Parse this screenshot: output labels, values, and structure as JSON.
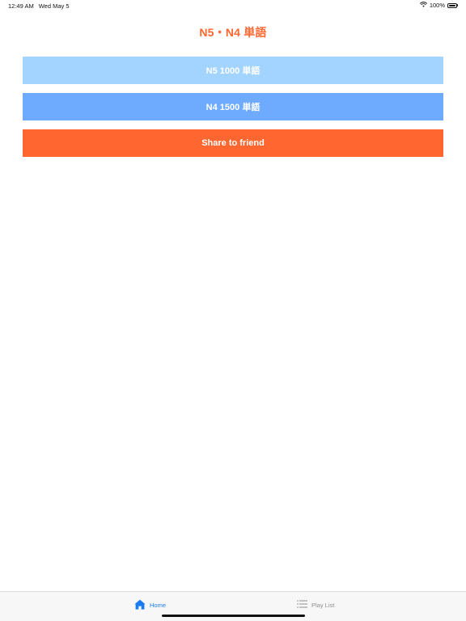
{
  "status_bar": {
    "time": "12:49 AM",
    "date": "Wed May 5",
    "battery": "100%",
    "battery_level": 1.0,
    "wifi_icon": "wifi-icon",
    "battery_icon": "battery-icon"
  },
  "header": {
    "title": "N5・N4 単語"
  },
  "buttons": {
    "n5_label": "N5 1000 単語",
    "n4_label": "N4 1500 単語",
    "share_label": "Share to friend"
  },
  "tab_bar": {
    "tabs": [
      {
        "label": "Home",
        "icon": "home-icon",
        "selected": true
      },
      {
        "label": "Play List",
        "icon": "list-icon",
        "selected": false
      }
    ]
  },
  "colors": {
    "accent": "#ff6630",
    "n5_button": "#a3d3ff",
    "n4_button": "#6eabff",
    "tab_selected": "#1b7cf2",
    "tab_unselected": "#8e8e93"
  }
}
